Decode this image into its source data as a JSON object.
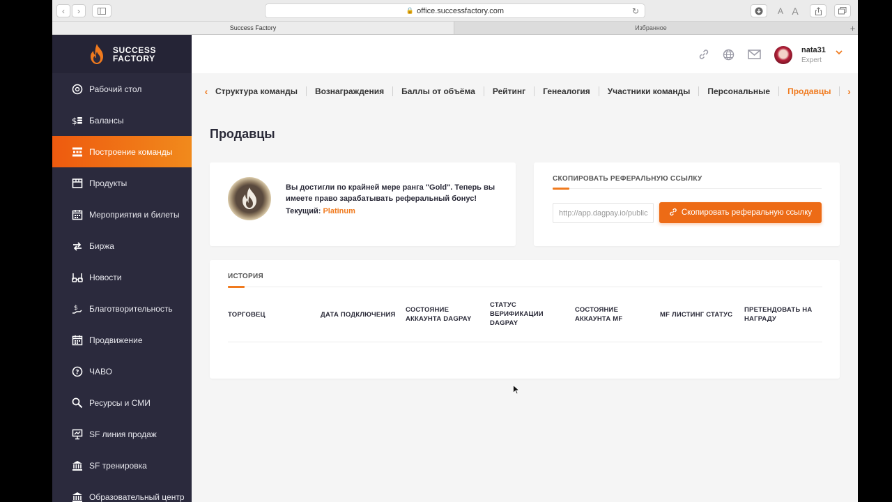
{
  "browser": {
    "url": "office.successfactory.com",
    "reader_small": "A",
    "reader_large": "A",
    "tabs": [
      {
        "label": "Success Factory"
      },
      {
        "label": "Избранное"
      }
    ],
    "new_tab": "+"
  },
  "brand": {
    "line1": "SUCCESS",
    "line2": "FACTORY"
  },
  "sidebar": {
    "items": [
      {
        "label": "Рабочий стол",
        "icon": "dashboard-icon"
      },
      {
        "label": "Балансы",
        "icon": "coins-icon"
      },
      {
        "label": "Построение команды",
        "icon": "team-structure-icon",
        "active": true
      },
      {
        "label": "Продукты",
        "icon": "box-icon"
      },
      {
        "label": "Мероприятия и билеты",
        "icon": "calendar-icon"
      },
      {
        "label": "Биржа",
        "icon": "exchange-icon"
      },
      {
        "label": "Новости",
        "icon": "glasses-icon"
      },
      {
        "label": "Благотворительность",
        "icon": "charity-icon"
      },
      {
        "label": "Продвижение",
        "icon": "calendar-icon"
      },
      {
        "label": "ЧАВО",
        "icon": "help-icon"
      },
      {
        "label": "Ресурсы и СМИ",
        "icon": "search-icon"
      },
      {
        "label": "SF линия продаж",
        "icon": "presentation-icon"
      },
      {
        "label": "SF тренировка",
        "icon": "bank-icon"
      },
      {
        "label": "Образовательный центр",
        "icon": "bank-icon"
      }
    ]
  },
  "header": {
    "user_name": "nata31",
    "user_role": "Expert"
  },
  "subnav": {
    "items": [
      "Структура команды",
      "Вознаграждения",
      "Баллы от объёма",
      "Рейтинг",
      "Генеалогия",
      "Участники команды",
      "Персональные",
      "Продавцы"
    ],
    "active_index": 7
  },
  "page": {
    "title": "Продавцы"
  },
  "rank_card": {
    "message": "Вы достигли по крайней мере ранга \"Gold\". Теперь вы имеете право зарабатывать реферальный бонус!",
    "current_label": "Текущий:",
    "current_value": "Platinum"
  },
  "referral": {
    "title": "СКОПИРОВАТЬ РЕФЕРАЛЬНУЮ ССЫЛКУ",
    "link_value": "http://app.dagpay.io/public",
    "button_label": "Скопировать реферальную ссылку"
  },
  "history": {
    "title": "ИСТОРИЯ",
    "columns": [
      [
        "ТОРГОВЕЦ"
      ],
      [
        "ДАТА ПОДКЛЮЧЕНИЯ"
      ],
      [
        "СОСТОЯНИЕ",
        "АККАУНТА DAGPAY"
      ],
      [
        "СТАТУС",
        "ВЕРИФИКАЦИИ",
        "DAGPAY"
      ],
      [
        "СОСТОЯНИЕ",
        "АККАУНТА MF"
      ],
      [
        "MF ЛИСТИНГ СТАТУС"
      ],
      [
        "ПРЕТЕНДОВАТЬ НА",
        "НАГРАДУ"
      ]
    ],
    "rows": []
  },
  "colors": {
    "accent": "#f07a1e",
    "sidebar_bg": "#2b2a3d",
    "active_nav": "#ee5a0f"
  }
}
